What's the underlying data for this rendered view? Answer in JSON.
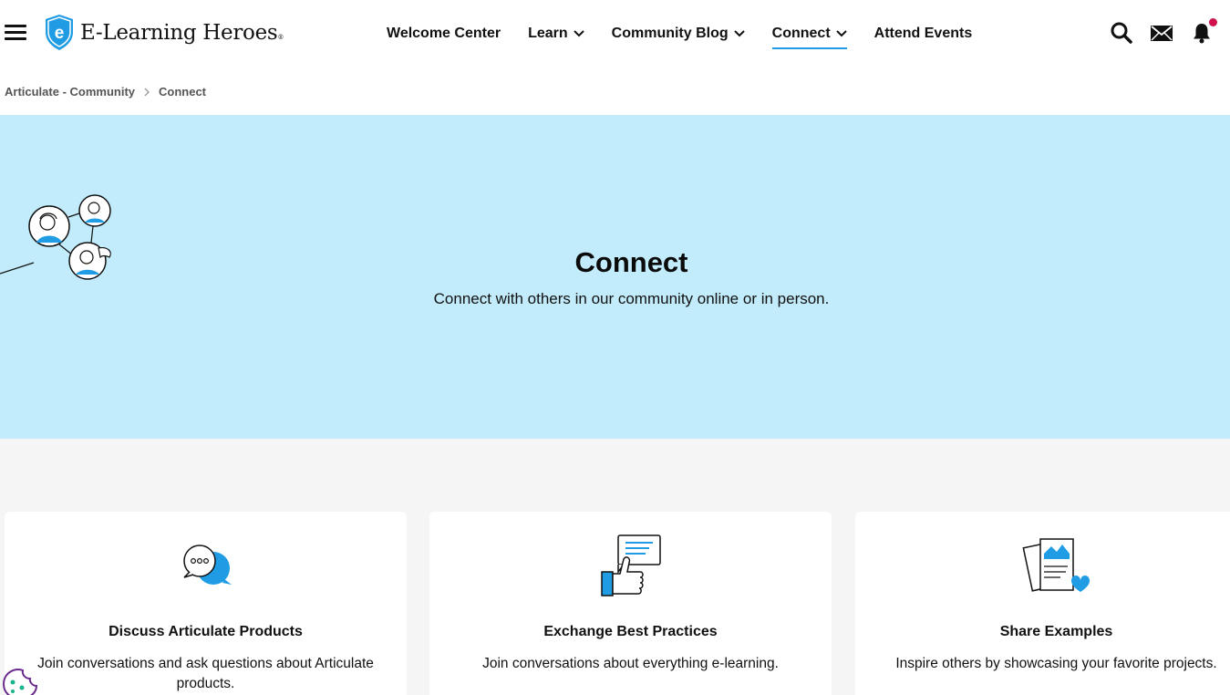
{
  "header": {
    "logo_text": "E-Learning Heroes",
    "logo_mark": "®",
    "nav": [
      {
        "label": "Welcome Center",
        "dropdown": false,
        "active": false
      },
      {
        "label": "Learn",
        "dropdown": true,
        "active": false
      },
      {
        "label": "Community Blog",
        "dropdown": true,
        "active": false
      },
      {
        "label": "Connect",
        "dropdown": true,
        "active": true
      },
      {
        "label": "Attend Events",
        "dropdown": false,
        "active": false
      }
    ],
    "icons": [
      "search-icon",
      "mail-icon",
      "bell-icon"
    ],
    "accent_color": "#1f9ce4",
    "notification_dot_color": "#d0104c"
  },
  "breadcrumb": {
    "items": [
      "Articulate - Community",
      "Connect"
    ]
  },
  "hero": {
    "title": "Connect",
    "subtitle": "Connect with others in our community online or in person.",
    "background": "#c2ecfb"
  },
  "cards": [
    {
      "icon": "chat-bubbles-icon",
      "title": "Discuss Articulate Products",
      "description": "Join conversations and ask questions about Articulate products."
    },
    {
      "icon": "thumbs-up-message-icon",
      "title": "Exchange Best Practices",
      "description": "Join conversations about everything e-learning."
    },
    {
      "icon": "documents-heart-icon",
      "title": "Share Examples",
      "description": "Inspire others by showcasing your favorite projects."
    }
  ]
}
